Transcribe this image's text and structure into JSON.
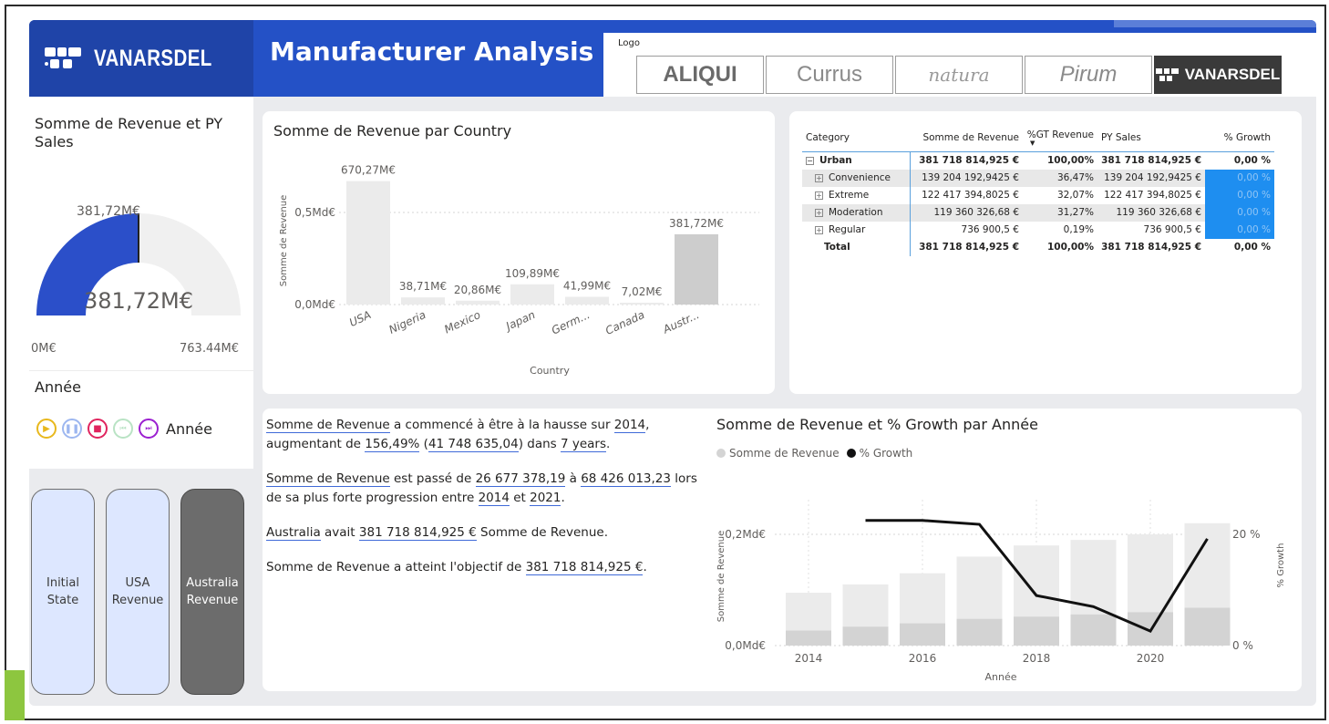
{
  "header": {
    "brand": "VANARSDEL",
    "title": "Manufacturer Analysis",
    "logo_slicer": {
      "caption": "Logo",
      "items": [
        "ALIQUI",
        "Currus",
        "natura",
        "Pirum",
        "VANARSDEL"
      ],
      "selected": "VANARSDEL"
    }
  },
  "gauge": {
    "title": "Somme de Revenue et PY Sales",
    "value": 381.72,
    "value_label": "381,72M€",
    "target_label": "381,72M€",
    "min_label": "0M€",
    "max_label": "763,44M€",
    "min": 0,
    "max": 763.44,
    "fill_color": "#2b4fc9",
    "track_color": "#f0f0f0"
  },
  "year_slicer": {
    "title": "Année",
    "play_label": "Année"
  },
  "bookmarks": [
    "Initial\nState",
    "USA\nRevenue",
    "Australia\nRevenue"
  ],
  "country_chart": {
    "title": "Somme de Revenue par Country",
    "xlabel": "Country",
    "ylabel": "Somme de Revenue",
    "yticks": [
      "0,5Md€",
      "0,0Md€"
    ],
    "categories": [
      "USA",
      "Nigeria",
      "Mexico",
      "Japan",
      "Germ...",
      "Canada",
      "Austr..."
    ],
    "values": [
      670.27,
      38.71,
      20.86,
      109.89,
      41.99,
      7.02,
      381.72
    ],
    "labels": [
      "670,27M€",
      "38,71M€",
      "20,86M€",
      "109,89M€",
      "41,99M€",
      "7,02M€",
      "381,72M€"
    ]
  },
  "matrix": {
    "headers": [
      "Category",
      "Somme de Revenue",
      "%GT Revenue",
      "PY Sales",
      "% Growth"
    ],
    "rows": [
      {
        "category": "Urban",
        "revenue": "381 718 814,925 €",
        "gt": "100,00%",
        "py": "381 718 814,925 €",
        "growth": "0,00 %"
      },
      {
        "category": "Convenience",
        "revenue": "139 204 192,9425 €",
        "gt": "36,47%",
        "py": "139 204 192,9425 €",
        "growth": "0,00 %"
      },
      {
        "category": "Extreme",
        "revenue": "122 417 394,8025 €",
        "gt": "32,07%",
        "py": "122 417 394,8025 €",
        "growth": "0,00 %"
      },
      {
        "category": "Moderation",
        "revenue": "119 360 326,68 €",
        "gt": "31,27%",
        "py": "119 360 326,68 €",
        "growth": "0,00 %"
      },
      {
        "category": "Regular",
        "revenue": "736 900,5 €",
        "gt": "0,19%",
        "py": "736 900,5 €",
        "growth": "0,00 %"
      }
    ],
    "total": {
      "category": "Total",
      "revenue": "381 718 814,925 €",
      "gt": "100,00%",
      "py": "381 718 814,925 €",
      "growth": "0,00 %"
    }
  },
  "narrative": {
    "p1": {
      "a": "Somme de Revenue",
      "b": " a commencé à être à la hausse sur ",
      "c": "2014",
      "d": ", augmentant de ",
      "e": "156,49%",
      "f": " (",
      "g": "41 748 635,04",
      "h": ") dans ",
      "i": "7 years",
      "j": "."
    },
    "p2": {
      "a": "Somme de Revenue",
      "b": " est passé de ",
      "c": "26 677 378,19",
      "d": " à ",
      "e": "68 426 013,23",
      "f": " lors de sa plus forte progression entre ",
      "g": "2014",
      "h": " et ",
      "i": "2021",
      "j": "."
    },
    "p3": {
      "a": "Australia",
      "b": " avait ",
      "c": "381 718 814,925 €",
      "d": " Somme de Revenue."
    },
    "p4": {
      "a": "Somme de Revenue a atteint l'objectif de ",
      "b": "381 718 814,925 €",
      "c": "."
    }
  },
  "combo_chart": {
    "title": "Somme de Revenue et % Growth par Année",
    "legend": [
      "Somme de Revenue",
      "% Growth"
    ],
    "xlabel": "Année",
    "ylabel_left": "Somme de Revenue",
    "ylabel_right": "% Growth",
    "yticks_left": [
      "0,2Md€",
      "0,0Md€"
    ],
    "yticks_right": [
      "20 %",
      "0 %"
    ],
    "xticks": [
      "2014",
      "2016",
      "2018",
      "2020"
    ]
  },
  "chart_data": [
    {
      "type": "bar",
      "title": "Somme de Revenue par Country",
      "xlabel": "Country",
      "ylabel": "Somme de Revenue",
      "categories": [
        "USA",
        "Nigeria",
        "Mexico",
        "Japan",
        "Germ...",
        "Canada",
        "Austr..."
      ],
      "values": [
        670.27,
        38.71,
        20.86,
        109.89,
        41.99,
        7.02,
        381.72
      ],
      "unit": "M€"
    },
    {
      "type": "bar",
      "title": "Somme de Revenue et % Growth par Année",
      "x": [
        2014,
        2015,
        2016,
        2017,
        2018,
        2019,
        2020,
        2021
      ],
      "series": [
        {
          "name": "Somme de Revenue",
          "values": [
            0.095,
            0.11,
            0.13,
            0.16,
            0.18,
            0.19,
            0.2,
            0.22
          ],
          "unit": "Md€"
        },
        {
          "name": "Somme de Revenue",
          "values": [
            0.027,
            0.034,
            0.04,
            0.048,
            0.052,
            0.056,
            0.06,
            0.068
          ],
          "unit": "Md€"
        },
        {
          "name": "% Growth",
          "type": "line",
          "x": [
            2015,
            2016,
            2017,
            2018,
            2019,
            2020,
            2021
          ],
          "values": [
            22.5,
            22.5,
            21.8,
            9.0,
            7.0,
            2.6,
            19.2
          ],
          "unit": "%"
        }
      ],
      "ylim_left": [
        0,
        0.26
      ],
      "ylim_right": [
        0,
        26
      ],
      "yticks_left": [
        "0,0Md€",
        "0,2Md€"
      ],
      "yticks_right": [
        "0 %",
        "20 %"
      ]
    }
  ]
}
